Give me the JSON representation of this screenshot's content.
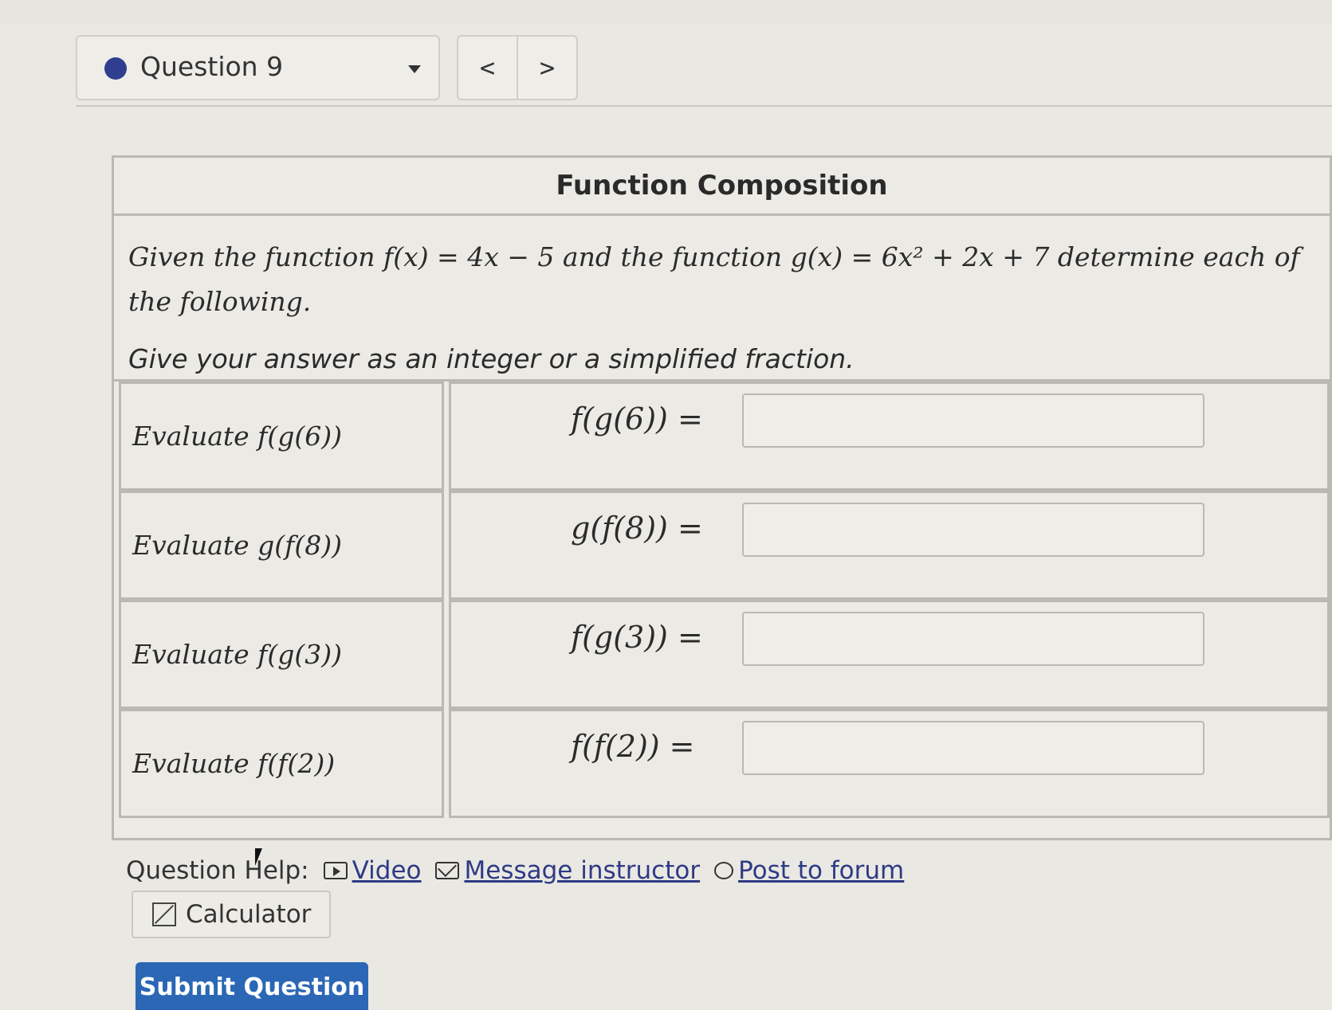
{
  "header": {
    "question_label": "Question 9",
    "prev_symbol": "<",
    "next_symbol": ">"
  },
  "card": {
    "title": "Function Composition",
    "intro": "Given the function f(x) = 4x − 5 and the function g(x) = 6x² + 2x + 7 determine each of the following.",
    "instruction": "Give your answer as an integer or a simplified fraction.",
    "rows": [
      {
        "prompt": "Evaluate f(g(6))",
        "expr": "f(g(6)) =",
        "answer": ""
      },
      {
        "prompt": "Evaluate g(f(8))",
        "expr": "g(f(8)) =",
        "answer": ""
      },
      {
        "prompt": "Evaluate f(g(3))",
        "expr": "f(g(3)) =",
        "answer": ""
      },
      {
        "prompt": "Evaluate f(f(2))",
        "expr": "f(f(2)) =",
        "answer": ""
      }
    ]
  },
  "help": {
    "label": "Question Help:",
    "video": "Video",
    "message": "Message instructor",
    "forum": "Post to forum"
  },
  "calculator": "Calculator",
  "submit": "Submit Question",
  "colors": {
    "accent": "#2f3e8f",
    "submit": "#2b67b5",
    "link": "#2e3a86"
  }
}
